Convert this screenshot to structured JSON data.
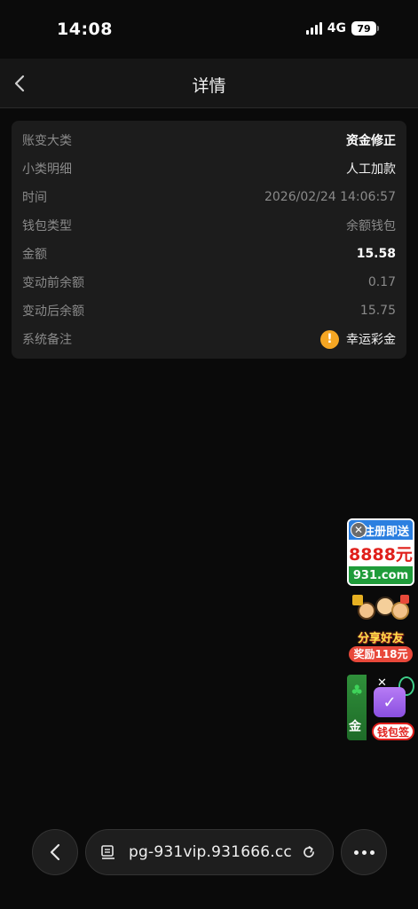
{
  "status_bar": {
    "time": "14:08",
    "network": "4G",
    "battery": "79"
  },
  "nav": {
    "back_icon": "chevron-left-icon",
    "title": "详情"
  },
  "details": {
    "rows": [
      {
        "label": "账变大类",
        "value": "资金修正"
      },
      {
        "label": "小类明细",
        "value": "人工加款"
      },
      {
        "label": "时间",
        "value": "2026/02/24 14:06:57"
      },
      {
        "label": "钱包类型",
        "value": "余额钱包"
      },
      {
        "label": "金额",
        "value": "15.58"
      },
      {
        "label": "变动前余额",
        "value": "0.17"
      },
      {
        "label": "变动后余额",
        "value": "15.75"
      },
      {
        "label": "系统备注",
        "value": "幸运彩金",
        "icon": "warning-icon"
      }
    ]
  },
  "promos": {
    "promo1": {
      "line1": "注册即送",
      "line2": "8888元",
      "line3": "931.com"
    },
    "promo2": {
      "line1": "分享好友",
      "line2": "奖励118元"
    },
    "promo3": {
      "left_text": "金",
      "label": "钱包签"
    }
  },
  "browser": {
    "url": "pg-931vip.931666.cc"
  },
  "colors": {
    "background": "#0a0a0a",
    "card": "#1c1c1c",
    "warning": "#f5a623"
  }
}
